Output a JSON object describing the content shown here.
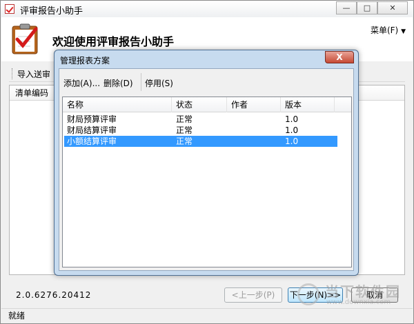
{
  "window": {
    "title": "评审报告小助手",
    "controls": {
      "minimize": "—",
      "maximize": "□",
      "close": "✕"
    }
  },
  "header": {
    "welcome": "欢迎使用评审报告小助手",
    "menu_label": "菜单(F)",
    "menu_arrow": "▼"
  },
  "toolbar": {
    "import_label": "导入送审"
  },
  "main_grid": {
    "column_label": "清单编码"
  },
  "footer": {
    "version": "2.0.6276.20412",
    "prev_label": "<上一步(P)",
    "next_label": "下一步(N)>>",
    "cancel_label": "取消"
  },
  "status": {
    "text": "就绪"
  },
  "watermark": {
    "line1": "当下软件园",
    "line2": "www.downxia.com"
  },
  "dialog": {
    "title": "管理报表方案",
    "close_label": "X",
    "tools": {
      "add": "添加(A)...",
      "delete": "删除(D)",
      "disable": "停用(S)"
    },
    "columns": {
      "name": "名称",
      "status": "状态",
      "author": "作者",
      "version": "版本"
    },
    "rows": [
      {
        "name": "财局预算评审",
        "status": "正常",
        "author": "",
        "version": "1.0"
      },
      {
        "name": "财局结算评审",
        "status": "正常",
        "author": "",
        "version": "1.0"
      },
      {
        "name": "小额结算评审",
        "status": "正常",
        "author": "",
        "version": "1.0"
      }
    ],
    "selected_row": 2
  },
  "colors": {
    "selection": "#3399ff",
    "dialog_frame": "#c7dbef",
    "close_red": "#c74a34"
  }
}
